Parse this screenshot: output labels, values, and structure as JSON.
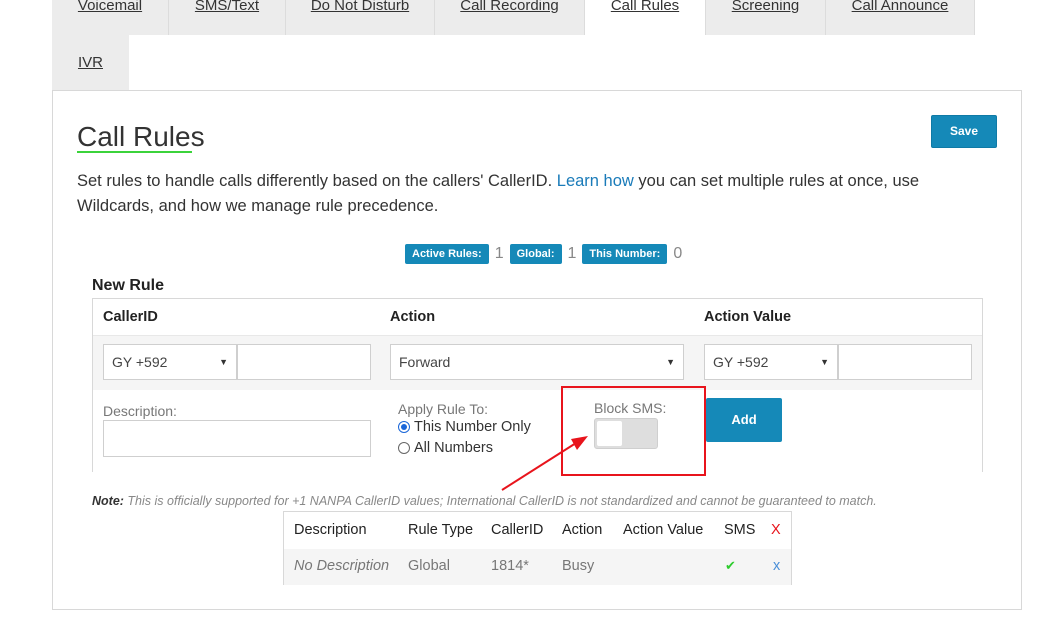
{
  "tabs": [
    {
      "label": "Voicemail"
    },
    {
      "label": "SMS/Text"
    },
    {
      "label": "Do Not Disturb"
    },
    {
      "label": "Call Recording"
    },
    {
      "label": "Call Rules"
    },
    {
      "label": "Screening"
    },
    {
      "label": "Call Announce"
    },
    {
      "label": "IVR"
    }
  ],
  "active_tab": "Call Rules",
  "page": {
    "title": "Call Rules",
    "save_label": "Save",
    "description_pre": "Set rules to handle calls differently based on the callers' CallerID. ",
    "description_link": "Learn how",
    "description_post": " you can set multiple rules at once, use Wildcards, and how we manage rule precedence."
  },
  "counts": {
    "active_label": "Active Rules:",
    "active_value": "1",
    "global_label": "Global:",
    "global_value": "1",
    "number_label": "This Number:",
    "number_value": "0"
  },
  "new_rule": {
    "heading": "New Rule",
    "col_callerid": "CallerID",
    "col_action": "Action",
    "col_action_value": "Action Value",
    "callerid_country": "GY +592",
    "callerid_value": "",
    "action_selected": "Forward",
    "action_value_country": "GY +592",
    "action_value_value": "",
    "description_label": "Description:",
    "apply_label": "Apply Rule To:",
    "apply_options": [
      "This Number Only",
      "All Numbers"
    ],
    "apply_selected": "This Number Only",
    "block_sms_label": "Block SMS:",
    "block_sms_on": false,
    "add_label": "Add"
  },
  "note": {
    "bold": "Note:",
    "text": " This is officially supported for +1 NANPA CallerID values; International CallerID is not standardized and cannot be guaranteed to match."
  },
  "rules_table": {
    "headers": [
      "Description",
      "Rule Type",
      "CallerID",
      "Action",
      "Action Value",
      "SMS",
      "X"
    ],
    "rows": [
      {
        "description": "No Description",
        "rule_type": "Global",
        "callerid": "1814*",
        "action": "Busy",
        "action_value": "",
        "sms": "✔",
        "delete": "x"
      }
    ]
  },
  "colors": {
    "accent": "#1589b8",
    "highlight": "#e8141c",
    "title_underline": "#3bd33b",
    "check": "#2ecc2e"
  }
}
